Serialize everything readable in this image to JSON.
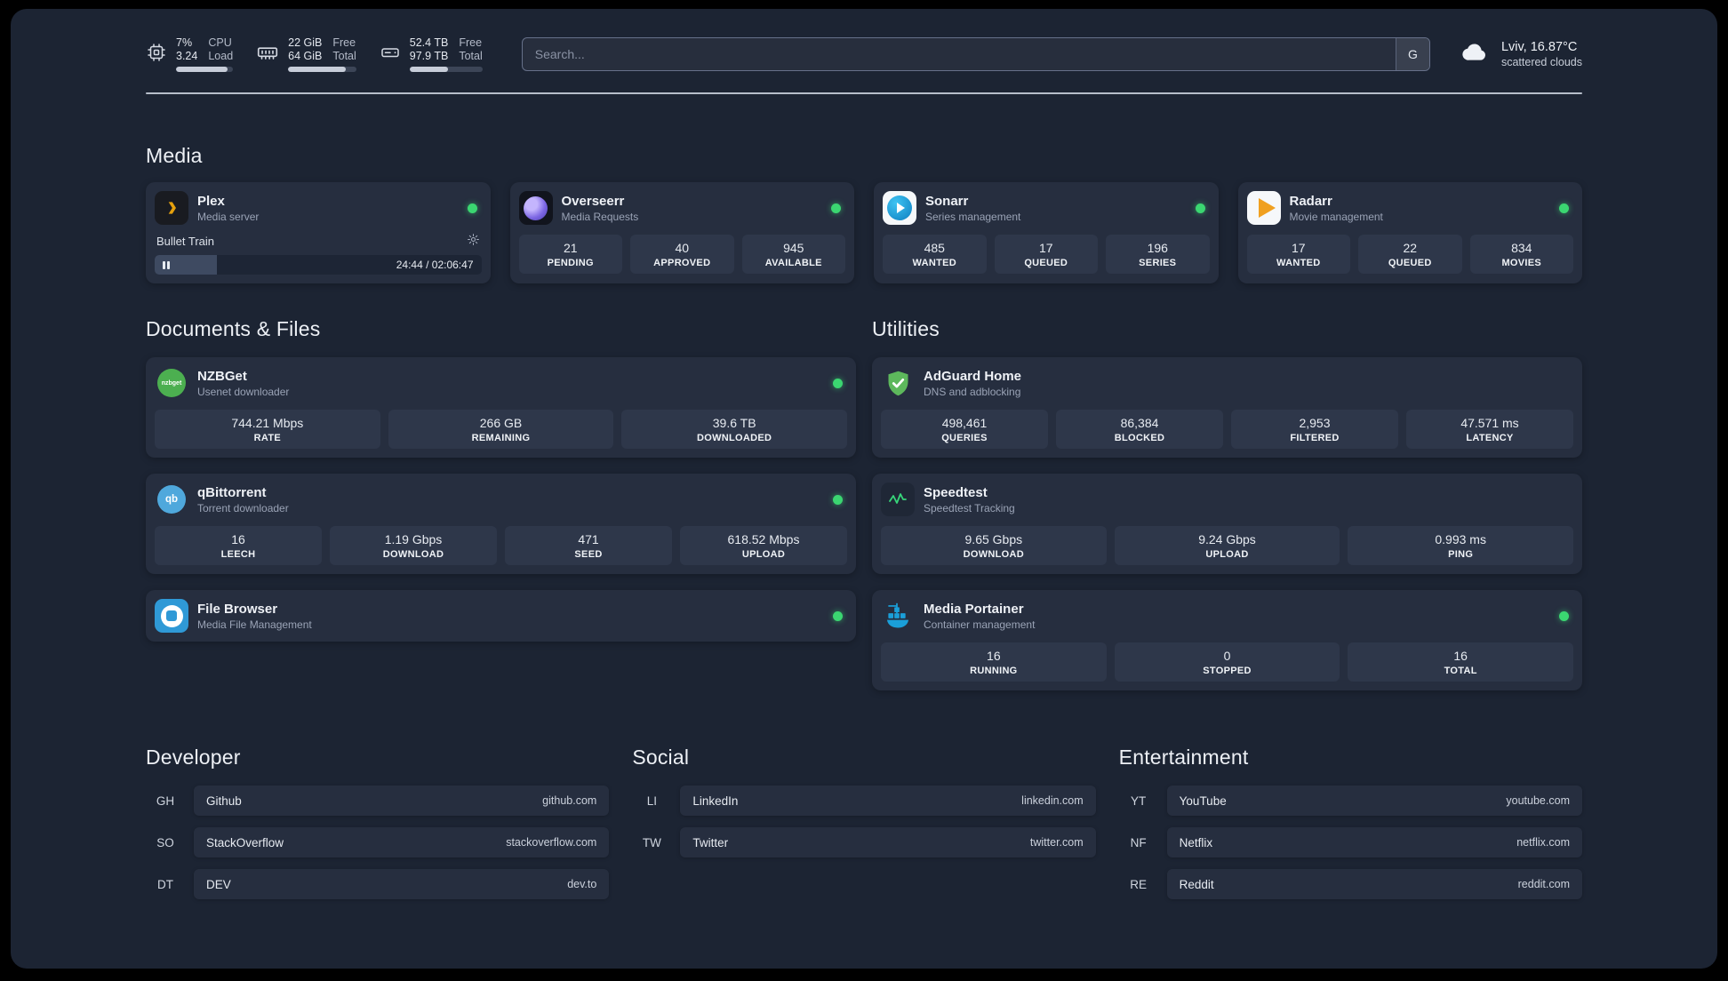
{
  "header": {
    "cpu": {
      "percent": "7%",
      "load": "3.24",
      "labels": [
        "CPU",
        "Load"
      ],
      "bar_percent": 90
    },
    "ram": {
      "free": "22 GiB",
      "total": "64 GiB",
      "labels": [
        "Free",
        "Total"
      ],
      "bar_percent": 85
    },
    "disk": {
      "free": "52.4 TB",
      "total": "97.9 TB",
      "labels": [
        "Free",
        "Total"
      ],
      "bar_percent": 53
    },
    "search": {
      "placeholder": "Search...",
      "engine_label": "G"
    },
    "weather": {
      "location": "Lviv, 16.87°C",
      "condition": "scattered clouds"
    }
  },
  "sections": {
    "media": "Media",
    "documents": "Documents & Files",
    "utilities": "Utilities",
    "developer": "Developer",
    "social": "Social",
    "entertainment": "Entertainment"
  },
  "apps": {
    "plex": {
      "name": "Plex",
      "desc": "Media server",
      "now_playing": "Bullet Train",
      "time": "24:44 / 02:06:47",
      "progress_percent": 19
    },
    "overseerr": {
      "name": "Overseerr",
      "desc": "Media Requests",
      "stats": [
        {
          "value": "21",
          "label": "PENDING"
        },
        {
          "value": "40",
          "label": "APPROVED"
        },
        {
          "value": "945",
          "label": "AVAILABLE"
        }
      ]
    },
    "sonarr": {
      "name": "Sonarr",
      "desc": "Series management",
      "stats": [
        {
          "value": "485",
          "label": "WANTED"
        },
        {
          "value": "17",
          "label": "QUEUED"
        },
        {
          "value": "196",
          "label": "SERIES"
        }
      ]
    },
    "radarr": {
      "name": "Radarr",
      "desc": "Movie management",
      "stats": [
        {
          "value": "17",
          "label": "WANTED"
        },
        {
          "value": "22",
          "label": "QUEUED"
        },
        {
          "value": "834",
          "label": "MOVIES"
        }
      ]
    },
    "nzbget": {
      "name": "NZBGet",
      "desc": "Usenet downloader",
      "icon_text": "nzbget",
      "stats": [
        {
          "value": "744.21 Mbps",
          "label": "RATE"
        },
        {
          "value": "266 GB",
          "label": "REMAINING"
        },
        {
          "value": "39.6 TB",
          "label": "DOWNLOADED"
        }
      ]
    },
    "qbittorrent": {
      "name": "qBittorrent",
      "desc": "Torrent downloader",
      "icon_text": "qb",
      "stats": [
        {
          "value": "16",
          "label": "LEECH"
        },
        {
          "value": "1.19 Gbps",
          "label": "DOWNLOAD"
        },
        {
          "value": "471",
          "label": "SEED"
        },
        {
          "value": "618.52 Mbps",
          "label": "UPLOAD"
        }
      ]
    },
    "filebrowser": {
      "name": "File Browser",
      "desc": "Media File Management"
    },
    "adguard": {
      "name": "AdGuard Home",
      "desc": "DNS and adblocking",
      "stats": [
        {
          "value": "498,461",
          "label": "QUERIES"
        },
        {
          "value": "86,384",
          "label": "BLOCKED"
        },
        {
          "value": "2,953",
          "label": "FILTERED"
        },
        {
          "value": "47.571 ms",
          "label": "LATENCY"
        }
      ]
    },
    "speedtest": {
      "name": "Speedtest",
      "desc": "Speedtest Tracking",
      "stats": [
        {
          "value": "9.65 Gbps",
          "label": "DOWNLOAD"
        },
        {
          "value": "9.24 Gbps",
          "label": "UPLOAD"
        },
        {
          "value": "0.993 ms",
          "label": "PING"
        }
      ]
    },
    "portainer": {
      "name": "Media Portainer",
      "desc": "Container management",
      "stats": [
        {
          "value": "16",
          "label": "RUNNING"
        },
        {
          "value": "0",
          "label": "STOPPED"
        },
        {
          "value": "16",
          "label": "TOTAL"
        }
      ]
    }
  },
  "links": {
    "developer": [
      {
        "abbr": "GH",
        "name": "Github",
        "url": "github.com"
      },
      {
        "abbr": "SO",
        "name": "StackOverflow",
        "url": "stackoverflow.com"
      },
      {
        "abbr": "DT",
        "name": "DEV",
        "url": "dev.to"
      }
    ],
    "social": [
      {
        "abbr": "LI",
        "name": "LinkedIn",
        "url": "linkedin.com"
      },
      {
        "abbr": "TW",
        "name": "Twitter",
        "url": "twitter.com"
      }
    ],
    "entertainment": [
      {
        "abbr": "YT",
        "name": "YouTube",
        "url": "youtube.com"
      },
      {
        "abbr": "NF",
        "name": "Netflix",
        "url": "netflix.com"
      },
      {
        "abbr": "RE",
        "name": "Reddit",
        "url": "reddit.com"
      }
    ]
  },
  "colors": {
    "accent_green": "#3bd671",
    "panel": "#1c2433",
    "card": "#262e3f"
  }
}
